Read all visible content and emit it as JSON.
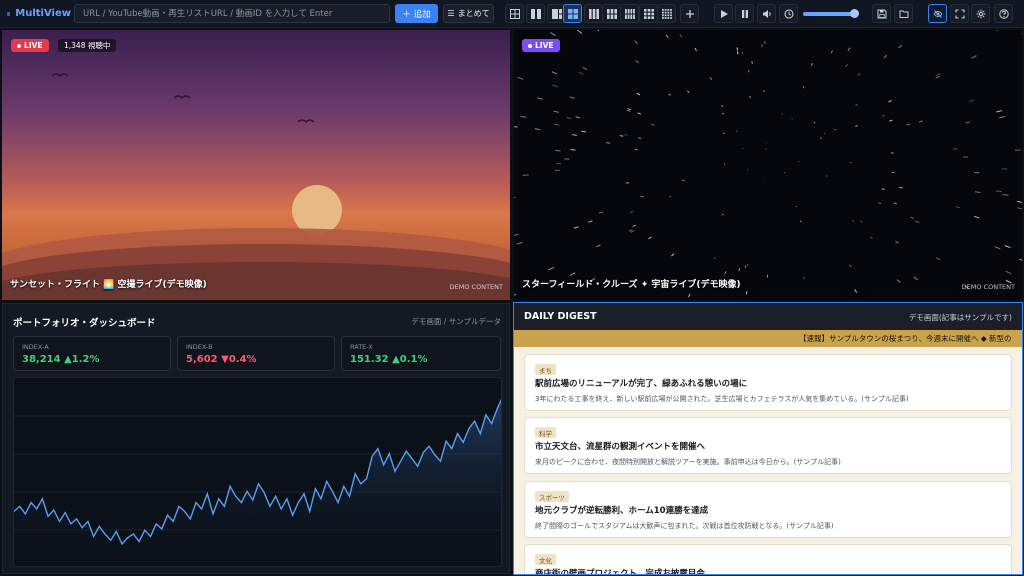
{
  "app": {
    "name": "MultiView"
  },
  "toolbar": {
    "url_placeholder": "URL / YouTube動画・再生リストURL / 動画ID を入力して Enter",
    "add_label": "追加",
    "batch_label": "まとめて",
    "volume_level": 0.9,
    "accent_color": "#3b82f6"
  },
  "tiles": [
    {
      "live_label": "LIVE",
      "live_color": "#e5394b",
      "viewers": "1,348 視聴中",
      "title": "サンセット・フライト 🌅 空撮ライブ(デモ映像)",
      "demo_label": "DEMO CONTENT"
    },
    {
      "live_label": "LIVE",
      "live_color": "#7c4df0",
      "title": "スターフィールド・クルーズ ✦ 宇宙ライブ(デモ映像)",
      "demo_label": "DEMO CONTENT"
    }
  ],
  "portfolio": {
    "title": "ポートフォリオ・ダッシュボード",
    "subtitle": "デモ画面 / サンプルデータ",
    "cards": [
      {
        "label": "INDEX-A",
        "value": "38,214",
        "change": "▲1.2%",
        "color": "#3fd07f"
      },
      {
        "label": "INDEX-B",
        "value": "5,602",
        "change": "▼0.4%",
        "color": "#ff5a6e"
      },
      {
        "label": "RATE-X",
        "value": "151.32",
        "change": "▲0.1%",
        "color": "#3fd07f"
      }
    ]
  },
  "chart_data": {
    "type": "line",
    "values": [
      48,
      52,
      46,
      55,
      50,
      58,
      44,
      49,
      40,
      47,
      38,
      42,
      35,
      40,
      28,
      36,
      30,
      25,
      32,
      22,
      27,
      30,
      24,
      33,
      28,
      38,
      34,
      45,
      40,
      52,
      48,
      42,
      55,
      50,
      62,
      46,
      58,
      52,
      68,
      60,
      55,
      64,
      57,
      70,
      63,
      52,
      60,
      50,
      58,
      45,
      55,
      62,
      48,
      66,
      58,
      72,
      64,
      55,
      68,
      60,
      78,
      70,
      74,
      92,
      98,
      85,
      94,
      80,
      88,
      96,
      90,
      84,
      95,
      100,
      93,
      88,
      104,
      98,
      110,
      103,
      114,
      120,
      110,
      125,
      118,
      130,
      140
    ]
  },
  "digest": {
    "title": "DAILY DIGEST",
    "subtitle": "デモ画面(記事はサンプルです)",
    "ticker": "【速報】サンプルタウンの桜まつり、今週末に開催へ ◆ 新型の",
    "items": [
      {
        "tag": "まち",
        "headline": "駅前広場のリニューアルが完了、緑あふれる憩いの場に",
        "body": "3年にわたる工事を終え、新しい駅前広場が公開された。芝生広場とカフェテラスが人気を集めている。(サンプル記事)"
      },
      {
        "tag": "科学",
        "headline": "市立天文台、流星群の観測イベントを開催へ",
        "body": "来月のピークに合わせ、夜間特別開放と解説ツアーを実施。事前申込は今日から。(サンプル記事)"
      },
      {
        "tag": "スポーツ",
        "headline": "地元クラブが逆転勝利、ホーム10連勝を達成",
        "body": "終了間際のゴールでスタジアムは大歓声に包まれた。次戦は首位攻防戦となる。(サンプル記事)"
      },
      {
        "tag": "文化",
        "headline": "商店街の壁画プロジェクト、完成お披露目会",
        "body": ""
      }
    ]
  }
}
